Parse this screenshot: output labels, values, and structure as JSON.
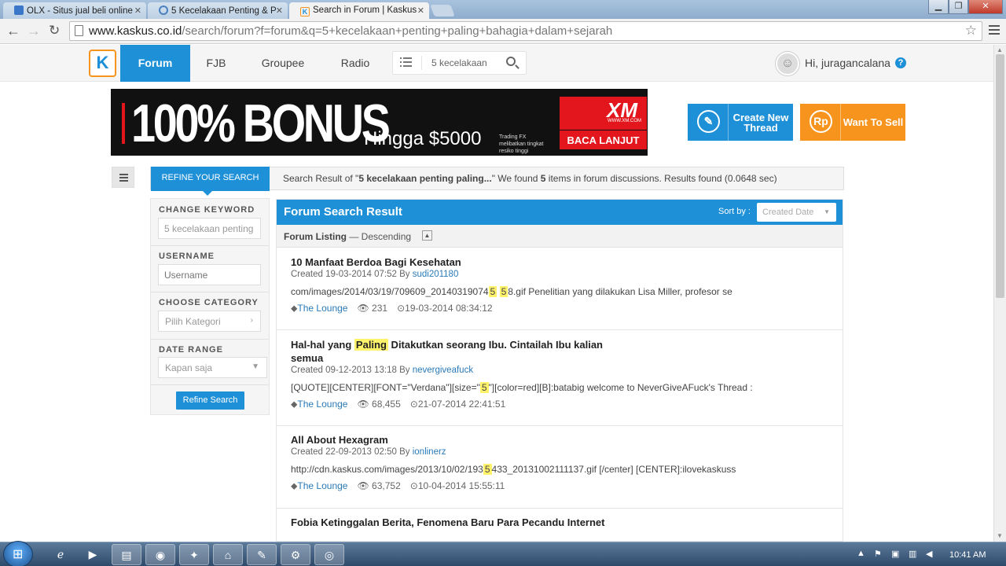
{
  "browser": {
    "tabs": [
      {
        "label": "OLX - Situs jual beli online",
        "active": false
      },
      {
        "label": "5 Kecelakaan Penting & P",
        "active": false
      },
      {
        "label": "Search in Forum | Kaskus",
        "active": true
      }
    ],
    "url_host": "www.kaskus.co.id",
    "url_path": "/search/forum?f=forum&q=5+kecelakaan+penting+paling+bahagia+dalam+sejarah"
  },
  "header": {
    "logo": "K",
    "nav": [
      "Forum",
      "FJB",
      "Groupee",
      "Radio"
    ],
    "search_value": "5 kecelakaan",
    "greeting": "Hi, juragancalana",
    "help": "?"
  },
  "banner": {
    "headline": "100% BONUS",
    "subline": "Hingga $5000",
    "risk_note": "Trading FX melibatkan tingkat resiko tinggi",
    "brand": "XM",
    "brand_url": "WWW.XM.COM",
    "cta": "BACA LANJUT"
  },
  "actions": {
    "create_thread": "Create New Thread",
    "create_icon": "✎",
    "want_to_sell": "Want To Sell",
    "sell_icon": "Rp"
  },
  "refine": {
    "tab_label": "REFINE YOUR SEARCH",
    "summary_prefix": "Search Result of \"",
    "query": "5 kecelakaan penting paling...",
    "summary_mid": "\" We found ",
    "count": "5",
    "summary_suffix": " items in forum discussions. Results found (0.0648 sec)"
  },
  "sidebar": {
    "keyword_label": "CHANGE KEYWORD",
    "keyword_value": "5 kecelakaan penting",
    "username_label": "USERNAME",
    "username_placeholder": "Username",
    "category_label": "CHOOSE CATEGORY",
    "category_value": "Pilih Kategori",
    "date_label": "DATE RANGE",
    "date_value": "Kapan saja",
    "refine_button": "Refine Search"
  },
  "results": {
    "title": "Forum Search Result",
    "sort_label": "Sort by :",
    "sort_value": "Created Date",
    "listing_label": "Forum Listing",
    "listing_order": " — Descending",
    "items": [
      {
        "title_parts": [
          "10 Manfaat Berdoa Bagi Kesehatan"
        ],
        "created": "Created 19-03-2014 07:52 By ",
        "author": "sudi201180",
        "snippet_parts": [
          "com/images/2014/03/19/709609_20140319074",
          "5",
          " ",
          "5",
          "8.gif Penelitian yang dilakukan Lisa Miller, profesor se"
        ],
        "category": "The Lounge",
        "views": "231",
        "last": "19-03-2014 08:34:12"
      },
      {
        "title_parts": [
          "Hal-hal yang ",
          "Paling",
          " Ditakutkan seorang Ibu. Cintailah Ibu kalian semua"
        ],
        "created": "Created 09-12-2013 13:18 By ",
        "author": "nevergiveafuck",
        "snippet_parts": [
          "[QUOTE][CENTER][FONT=\"Verdana\"][size=\"",
          "5",
          "\"][color=red][B]:batabig welcome to NeverGiveAFuck's Thread :"
        ],
        "category": "The Lounge",
        "views": "68,455",
        "last": "21-07-2014 22:41:51"
      },
      {
        "title_parts": [
          "All About Hexagram"
        ],
        "created": "Created 22-09-2013 02:50 By ",
        "author": "ionlinerz",
        "snippet_parts": [
          "http://cdn.kaskus.com/images/2013/10/02/193",
          "5",
          "433_20131002111137.gif [/center] [CENTER]:ilovekaskuss"
        ],
        "category": "The Lounge",
        "views": "63,752",
        "last": "10-04-2014 15:55:11"
      },
      {
        "title_parts": [
          "Fobia Ketinggalan Berita, Fenomena Baru Para Pecandu Internet"
        ]
      }
    ]
  },
  "taskbar": {
    "clock": "10:41 AM"
  }
}
